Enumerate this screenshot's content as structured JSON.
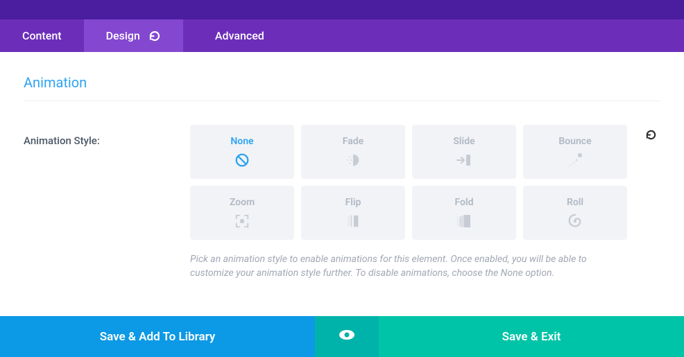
{
  "tabs": {
    "content": "Content",
    "design": "Design",
    "advanced": "Advanced"
  },
  "section": {
    "title": "Animation"
  },
  "field": {
    "label": "Animation Style:",
    "help": "Pick an animation style to enable animations for this element. Once enabled, you will be able to customize your animation style further. To disable animations, choose the None option."
  },
  "options": {
    "none": "None",
    "fade": "Fade",
    "slide": "Slide",
    "bounce": "Bounce",
    "zoom": "Zoom",
    "flip": "Flip",
    "fold": "Fold",
    "roll": "Roll"
  },
  "footer": {
    "saveLib": "Save & Add To Library",
    "saveExit": "Save & Exit"
  },
  "colors": {
    "accent": "#2ea3f2",
    "tabBg": "#6c2eb9",
    "tabActive": "#8347d0"
  }
}
